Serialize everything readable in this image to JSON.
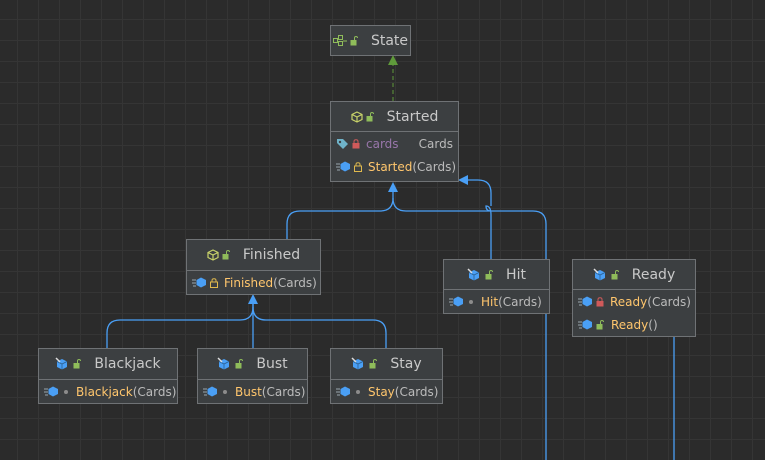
{
  "colors": {
    "edge": "#4a9ff5",
    "implements_edge": "#5f9a3b",
    "method_name": "#ffc66d",
    "field_name": "#9876aa"
  },
  "nodes": [
    {
      "id": "state",
      "title": "State",
      "kind": "interface",
      "fields": [],
      "methods": []
    },
    {
      "id": "started",
      "title": "Started",
      "kind": "abstract-class",
      "fields": [
        {
          "name": "cards",
          "type": "Cards",
          "visibility": "private"
        }
      ],
      "methods": [
        {
          "name": "Started",
          "params": "(Cards)",
          "visibility": "protected",
          "kind": "constructor"
        }
      ]
    },
    {
      "id": "finished",
      "title": "Finished",
      "kind": "abstract-class",
      "fields": [],
      "methods": [
        {
          "name": "Finished",
          "params": "(Cards)",
          "visibility": "protected",
          "kind": "constructor"
        }
      ]
    },
    {
      "id": "hit",
      "title": "Hit",
      "kind": "class",
      "fields": [],
      "methods": [
        {
          "name": "Hit",
          "params": "(Cards)",
          "visibility": "package",
          "kind": "constructor"
        }
      ]
    },
    {
      "id": "ready",
      "title": "Ready",
      "kind": "class",
      "fields": [],
      "methods": [
        {
          "name": "Ready",
          "params": "(Cards)",
          "visibility": "private",
          "kind": "constructor"
        },
        {
          "name": "Ready",
          "params": "()",
          "visibility": "public",
          "kind": "constructor"
        }
      ]
    },
    {
      "id": "blackjack",
      "title": "Blackjack",
      "kind": "class",
      "fields": [],
      "methods": [
        {
          "name": "Blackjack",
          "params": "(Cards)",
          "visibility": "package",
          "kind": "constructor"
        }
      ]
    },
    {
      "id": "bust",
      "title": "Bust",
      "kind": "class",
      "fields": [],
      "methods": [
        {
          "name": "Bust",
          "params": "(Cards)",
          "visibility": "package",
          "kind": "constructor"
        }
      ]
    },
    {
      "id": "stay",
      "title": "Stay",
      "kind": "class",
      "fields": [],
      "methods": [
        {
          "name": "Stay",
          "params": "(Cards)",
          "visibility": "package",
          "kind": "constructor"
        }
      ]
    }
  ],
  "edges": [
    {
      "from": "started",
      "to": "state",
      "type": "implements"
    },
    {
      "from": "finished",
      "to": "started",
      "type": "extends"
    },
    {
      "from": "hit",
      "to": "started",
      "type": "extends"
    },
    {
      "from": "blackjack",
      "to": "finished",
      "type": "extends"
    },
    {
      "from": "bust",
      "to": "finished",
      "type": "extends"
    },
    {
      "from": "stay",
      "to": "finished",
      "type": "extends"
    }
  ]
}
